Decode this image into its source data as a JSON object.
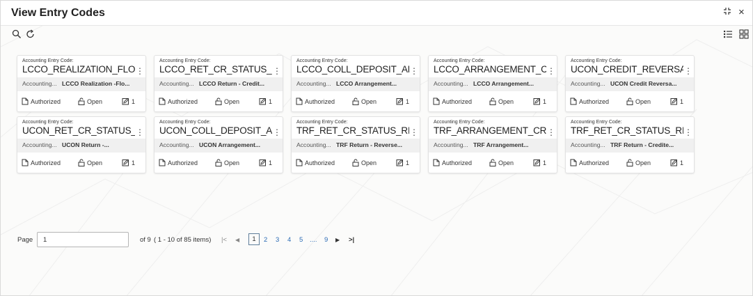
{
  "window": {
    "title": "View Entry Codes",
    "expand_icon": "expand-arrows-icon",
    "close_label": "×"
  },
  "toolbar": {
    "search_icon": "search-icon",
    "refresh_icon": "refresh-icon",
    "list_view_icon": "list-view-icon",
    "grid_view_icon": "grid-view-icon"
  },
  "card_common": {
    "code_label": "Accounting Entry Code:",
    "desc_label": "Accounting...",
    "menu_glyph": "⋮",
    "status_auth": "Authorized",
    "status_open": "Open",
    "edit_count": "1"
  },
  "cards": [
    {
      "code": "LCCO_REALIZATION_FLOAT",
      "desc": "LCCO Realization -Flo..."
    },
    {
      "code": "LCCO_RET_CR_STATUS_R...",
      "desc": "LCCO Return - Credit..."
    },
    {
      "code": "LCCO_COLL_DEPOSIT_AR...",
      "desc": "LCCO Arrangement..."
    },
    {
      "code": "LCCO_ARRANGEMENT_C...",
      "desc": "LCCO Arrangement..."
    },
    {
      "code": "UCON_CREDIT_REVERSA...",
      "desc": "UCON Credit Reversa..."
    },
    {
      "code": "UCON_RET_CR_STATUS_...",
      "desc": "UCON Return -..."
    },
    {
      "code": "UCON_COLL_DEPOSIT_A...",
      "desc": "UCON Arrangement..."
    },
    {
      "code": "TRF_RET_CR_STATUS_RE...",
      "desc": "TRF Return - Reverse..."
    },
    {
      "code": "TRF_ARRANGEMENT_CR...",
      "desc": "TRF Arrangement..."
    },
    {
      "code": "TRF_RET_CR_STATUS_RE...",
      "desc": "TRF Return - Credite..."
    }
  ],
  "pagination": {
    "page_label": "Page",
    "page_value": "1",
    "of_text": "of 9",
    "range_text": "( 1 - 10 of 85 items)",
    "first_glyph": "|<",
    "prev_glyph": "◀",
    "current_page": "1",
    "pages": [
      "2",
      "3",
      "4",
      "5",
      "....",
      "9"
    ],
    "next_glyph": "▶",
    "last_glyph": ">|"
  }
}
